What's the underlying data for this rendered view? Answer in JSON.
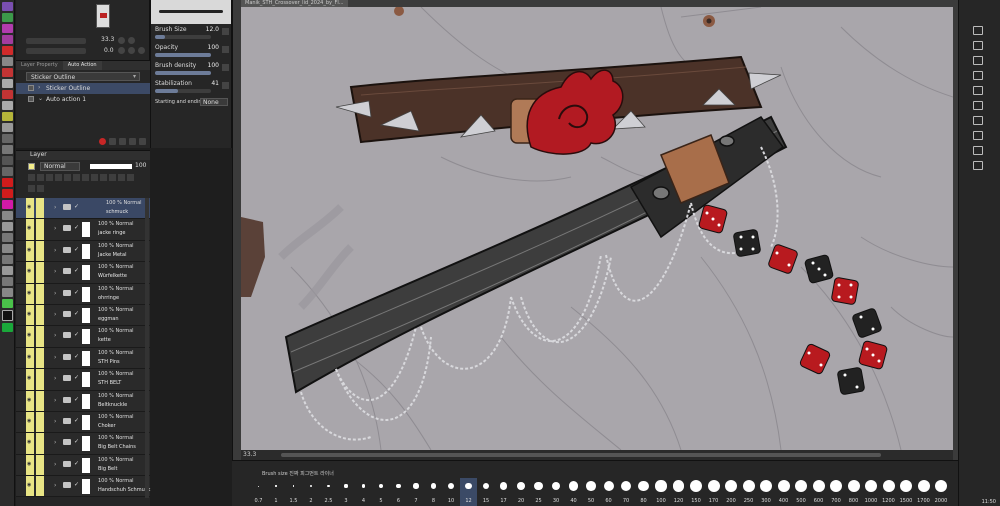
{
  "navigator": {
    "zoom": "33.3",
    "angle": "0.0"
  },
  "auto_action": {
    "tabs": [
      "Layer Property",
      "Auto Action"
    ],
    "selected_set": "Sticker Outline",
    "items": [
      "Sticker Outline",
      "Auto action 1"
    ]
  },
  "tool_property": {
    "brush_size_label": "Brush Size",
    "brush_size": "12.0",
    "opacity_label": "Opacity",
    "opacity": "100",
    "density_label": "Brush density",
    "density": "100",
    "stabilization_label": "Stabilization",
    "stabilization": "41",
    "start_end_label": "Starting and ending",
    "start_end": "None"
  },
  "layer_panel": {
    "tab": "Layer",
    "blend_mode": "Normal",
    "opacity": "100",
    "layers": [
      {
        "mode": "100 % Normal",
        "name": "schmuck",
        "active": true
      },
      {
        "mode": "100 % Normal",
        "name": "jacke ringe"
      },
      {
        "mode": "100 % Normal",
        "name": "Jacke Metal"
      },
      {
        "mode": "100 % Normal",
        "name": "Würfelkette"
      },
      {
        "mode": "100 % Normal",
        "name": "ohrringe"
      },
      {
        "mode": "100 % Normal",
        "name": "eggman"
      },
      {
        "mode": "100 % Normal",
        "name": "kette"
      },
      {
        "mode": "100 % Normal",
        "name": "STH Pins"
      },
      {
        "mode": "100 % Normal",
        "name": "STH BELT"
      },
      {
        "mode": "100 % Normal",
        "name": "Beltknuckle"
      },
      {
        "mode": "100 % Normal",
        "name": "Choker"
      },
      {
        "mode": "100 % Normal",
        "name": "Big Belt Chains"
      },
      {
        "mode": "100 % Normal",
        "name": "Big Belt"
      },
      {
        "mode": "100 % Normal",
        "name": "Handschuh Schmuck"
      }
    ]
  },
  "canvas": {
    "document_tab": "Manik_STH_Crossover_lid_2024_by_Fl...",
    "zoom": "33.3"
  },
  "brush_size_palette": {
    "title": "Brush size  진짜 피그먼트 라이너",
    "sizes": [
      "0.7",
      "1",
      "1.5",
      "2",
      "2.5",
      "3",
      "4",
      "5",
      "6",
      "7",
      "8",
      "10",
      "12",
      "15",
      "17",
      "20",
      "25",
      "30",
      "40",
      "50",
      "60",
      "70",
      "80",
      "100",
      "120",
      "150",
      "170",
      "200",
      "250",
      "300",
      "400",
      "500",
      "600",
      "700",
      "800",
      "1000",
      "1200",
      "1500",
      "1700",
      "2000"
    ],
    "selected": "12"
  },
  "clock": "11:50"
}
